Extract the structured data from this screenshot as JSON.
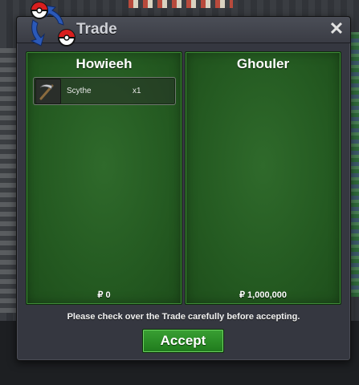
{
  "window": {
    "title": "Trade",
    "close_icon": "close-icon"
  },
  "left_panel": {
    "name": "Howieeh",
    "items": [
      {
        "icon": "scythe-icon",
        "name": "Scythe",
        "qty": "x1"
      }
    ],
    "money": "₽ 0"
  },
  "right_panel": {
    "name": "Ghouler",
    "items": [],
    "money": "₽ 1,000,000"
  },
  "footer": {
    "note": "Please check over the Trade carefully before accepting.",
    "accept_label": "Accept"
  },
  "colors": {
    "panel_green": "#245a21",
    "accept_green": "#2a8c26",
    "window_bg": "#353740"
  }
}
